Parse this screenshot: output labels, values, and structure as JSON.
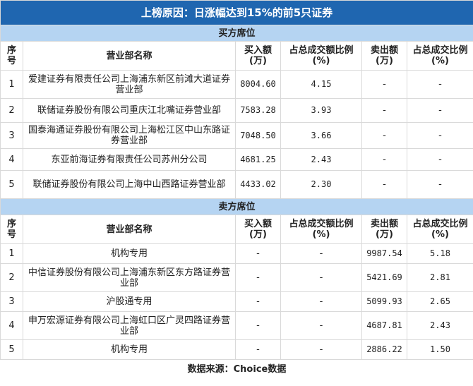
{
  "title": "上榜原因：日涨幅达到15%的前5只证券",
  "headers": [
    "序号",
    "营业部名称",
    "买入额(万)",
    "占总成交额比例(%)",
    "卖出额(万)",
    "占总成交比例(%)"
  ],
  "buy": {
    "label": "买方席位",
    "rows": [
      [
        "1",
        "爱建证券有限责任公司上海浦东新区前滩大道证券营业部",
        "8004.60",
        "4.15",
        "-",
        "-"
      ],
      [
        "2",
        "联储证券股份有限公司重庆江北嘴证券营业部",
        "7583.28",
        "3.93",
        "-",
        "-"
      ],
      [
        "3",
        "国泰海通证券股份有限公司上海松江区中山东路证券营业部",
        "7048.50",
        "3.66",
        "-",
        "-"
      ],
      [
        "4",
        "东亚前海证券有限责任公司苏州分公司",
        "4681.25",
        "2.43",
        "-",
        "-"
      ],
      [
        "5",
        "联储证券股份有限公司上海中山西路证券营业部",
        "4433.02",
        "2.30",
        "-",
        "-"
      ]
    ]
  },
  "sell": {
    "label": "卖方席位",
    "rows": [
      [
        "1",
        "机构专用",
        "-",
        "-",
        "9987.54",
        "5.18"
      ],
      [
        "2",
        "中信证券股份有限公司上海浦东新区东方路证券营业部",
        "-",
        "-",
        "5421.69",
        "2.81"
      ],
      [
        "3",
        "沪股通专用",
        "-",
        "-",
        "5099.93",
        "2.65"
      ],
      [
        "4",
        "申万宏源证券有限公司上海虹口区广灵四路证券营业部",
        "-",
        "-",
        "4687.81",
        "2.43"
      ],
      [
        "5",
        "机构专用",
        "-",
        "-",
        "2886.22",
        "1.50"
      ]
    ]
  },
  "footer": "数据来源：Choice数据"
}
